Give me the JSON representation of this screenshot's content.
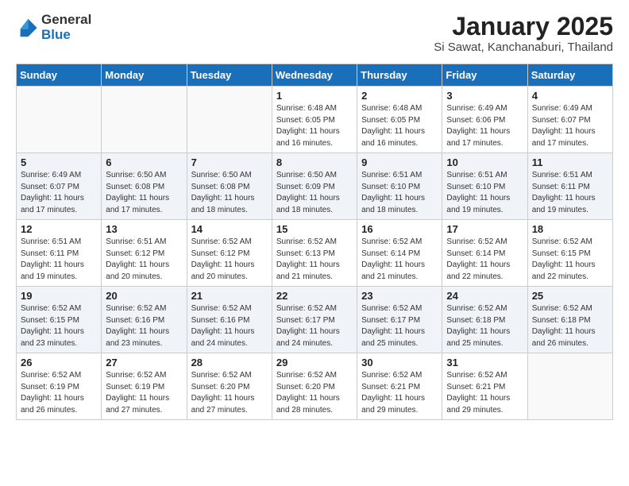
{
  "header": {
    "logo_general": "General",
    "logo_blue": "Blue",
    "month_title": "January 2025",
    "location": "Si Sawat, Kanchanaburi, Thailand"
  },
  "weekdays": [
    "Sunday",
    "Monday",
    "Tuesday",
    "Wednesday",
    "Thursday",
    "Friday",
    "Saturday"
  ],
  "weeks": [
    [
      {
        "num": "",
        "sunrise": "",
        "sunset": "",
        "daylight": ""
      },
      {
        "num": "",
        "sunrise": "",
        "sunset": "",
        "daylight": ""
      },
      {
        "num": "",
        "sunrise": "",
        "sunset": "",
        "daylight": ""
      },
      {
        "num": "1",
        "sunrise": "6:48 AM",
        "sunset": "6:05 PM",
        "daylight": "11 hours and 16 minutes."
      },
      {
        "num": "2",
        "sunrise": "6:48 AM",
        "sunset": "6:05 PM",
        "daylight": "11 hours and 16 minutes."
      },
      {
        "num": "3",
        "sunrise": "6:49 AM",
        "sunset": "6:06 PM",
        "daylight": "11 hours and 17 minutes."
      },
      {
        "num": "4",
        "sunrise": "6:49 AM",
        "sunset": "6:07 PM",
        "daylight": "11 hours and 17 minutes."
      }
    ],
    [
      {
        "num": "5",
        "sunrise": "6:49 AM",
        "sunset": "6:07 PM",
        "daylight": "11 hours and 17 minutes."
      },
      {
        "num": "6",
        "sunrise": "6:50 AM",
        "sunset": "6:08 PM",
        "daylight": "11 hours and 17 minutes."
      },
      {
        "num": "7",
        "sunrise": "6:50 AM",
        "sunset": "6:08 PM",
        "daylight": "11 hours and 18 minutes."
      },
      {
        "num": "8",
        "sunrise": "6:50 AM",
        "sunset": "6:09 PM",
        "daylight": "11 hours and 18 minutes."
      },
      {
        "num": "9",
        "sunrise": "6:51 AM",
        "sunset": "6:10 PM",
        "daylight": "11 hours and 18 minutes."
      },
      {
        "num": "10",
        "sunrise": "6:51 AM",
        "sunset": "6:10 PM",
        "daylight": "11 hours and 19 minutes."
      },
      {
        "num": "11",
        "sunrise": "6:51 AM",
        "sunset": "6:11 PM",
        "daylight": "11 hours and 19 minutes."
      }
    ],
    [
      {
        "num": "12",
        "sunrise": "6:51 AM",
        "sunset": "6:11 PM",
        "daylight": "11 hours and 19 minutes."
      },
      {
        "num": "13",
        "sunrise": "6:51 AM",
        "sunset": "6:12 PM",
        "daylight": "11 hours and 20 minutes."
      },
      {
        "num": "14",
        "sunrise": "6:52 AM",
        "sunset": "6:12 PM",
        "daylight": "11 hours and 20 minutes."
      },
      {
        "num": "15",
        "sunrise": "6:52 AM",
        "sunset": "6:13 PM",
        "daylight": "11 hours and 21 minutes."
      },
      {
        "num": "16",
        "sunrise": "6:52 AM",
        "sunset": "6:14 PM",
        "daylight": "11 hours and 21 minutes."
      },
      {
        "num": "17",
        "sunrise": "6:52 AM",
        "sunset": "6:14 PM",
        "daylight": "11 hours and 22 minutes."
      },
      {
        "num": "18",
        "sunrise": "6:52 AM",
        "sunset": "6:15 PM",
        "daylight": "11 hours and 22 minutes."
      }
    ],
    [
      {
        "num": "19",
        "sunrise": "6:52 AM",
        "sunset": "6:15 PM",
        "daylight": "11 hours and 23 minutes."
      },
      {
        "num": "20",
        "sunrise": "6:52 AM",
        "sunset": "6:16 PM",
        "daylight": "11 hours and 23 minutes."
      },
      {
        "num": "21",
        "sunrise": "6:52 AM",
        "sunset": "6:16 PM",
        "daylight": "11 hours and 24 minutes."
      },
      {
        "num": "22",
        "sunrise": "6:52 AM",
        "sunset": "6:17 PM",
        "daylight": "11 hours and 24 minutes."
      },
      {
        "num": "23",
        "sunrise": "6:52 AM",
        "sunset": "6:17 PM",
        "daylight": "11 hours and 25 minutes."
      },
      {
        "num": "24",
        "sunrise": "6:52 AM",
        "sunset": "6:18 PM",
        "daylight": "11 hours and 25 minutes."
      },
      {
        "num": "25",
        "sunrise": "6:52 AM",
        "sunset": "6:18 PM",
        "daylight": "11 hours and 26 minutes."
      }
    ],
    [
      {
        "num": "26",
        "sunrise": "6:52 AM",
        "sunset": "6:19 PM",
        "daylight": "11 hours and 26 minutes."
      },
      {
        "num": "27",
        "sunrise": "6:52 AM",
        "sunset": "6:19 PM",
        "daylight": "11 hours and 27 minutes."
      },
      {
        "num": "28",
        "sunrise": "6:52 AM",
        "sunset": "6:20 PM",
        "daylight": "11 hours and 27 minutes."
      },
      {
        "num": "29",
        "sunrise": "6:52 AM",
        "sunset": "6:20 PM",
        "daylight": "11 hours and 28 minutes."
      },
      {
        "num": "30",
        "sunrise": "6:52 AM",
        "sunset": "6:21 PM",
        "daylight": "11 hours and 29 minutes."
      },
      {
        "num": "31",
        "sunrise": "6:52 AM",
        "sunset": "6:21 PM",
        "daylight": "11 hours and 29 minutes."
      },
      {
        "num": "",
        "sunrise": "",
        "sunset": "",
        "daylight": ""
      }
    ]
  ]
}
